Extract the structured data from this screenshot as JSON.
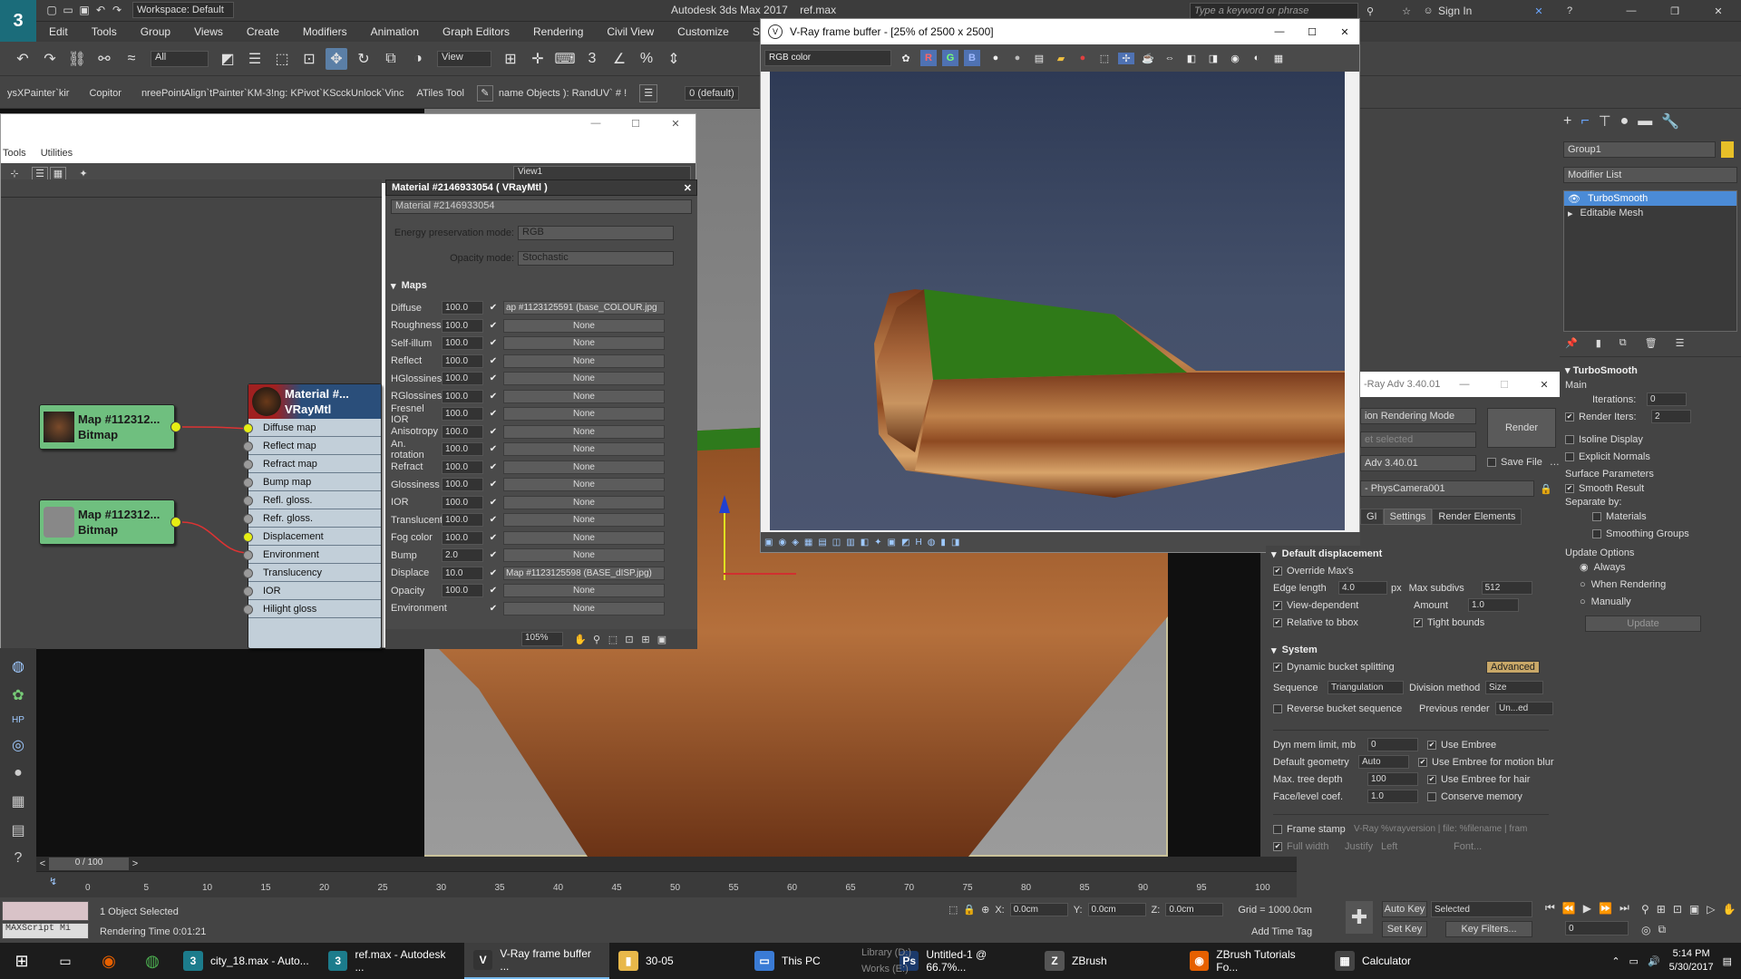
{
  "app": {
    "title": "Autodesk 3ds Max 2017",
    "file": "ref.max",
    "workspace": "Workspace: Default",
    "search_placeholder": "Type a keyword or phrase",
    "sign_in": "Sign In"
  },
  "menu": [
    "Edit",
    "Tools",
    "Group",
    "Views",
    "Create",
    "Modifiers",
    "Animation",
    "Graph Editors",
    "Rendering",
    "Civil View",
    "Customize",
    "Scripting"
  ],
  "toolbar": {
    "selection_filter": "All",
    "view_dropdown": "View"
  },
  "plugin_bar": [
    "ysXPainter`kir",
    "Copitor",
    "nreePointAlign`tPainter`KM-3!ng: KPivot`KScckUnlock`Vinc",
    "ATiles Tool",
    "name Objects ): RandUV` # !",
    "0 (default)"
  ],
  "slate": {
    "menu": [
      "Tools",
      "Utilities"
    ],
    "view_name": "View1",
    "nodes": {
      "map1_title": "Map #112312...",
      "map1_type": "Bitmap",
      "map2_title": "Map #112312...",
      "map2_type": "Bitmap",
      "mtl_title": "Material #...",
      "mtl_type": "VRayMtl"
    },
    "slots": [
      {
        "label": "Diffuse map",
        "connected": true
      },
      {
        "label": "Reflect map",
        "connected": false
      },
      {
        "label": "Refract map",
        "connected": false
      },
      {
        "label": "Bump map",
        "connected": false
      },
      {
        "label": "Refl. gloss.",
        "connected": false
      },
      {
        "label": "Refr. gloss.",
        "connected": false
      },
      {
        "label": "Displacement",
        "connected": true
      },
      {
        "label": "Environment",
        "connected": false
      },
      {
        "label": "Translucency",
        "connected": false
      },
      {
        "label": "IOR",
        "connected": false
      },
      {
        "label": "Hilight gloss",
        "connected": false
      }
    ],
    "zoom": "105%"
  },
  "params": {
    "header": "Material #2146933054  ( VRayMtl )",
    "name_field": "Material #2146933054",
    "energy_label": "Energy preservation mode:",
    "energy_value": "RGB",
    "opacity_label": "Opacity mode:",
    "opacity_value": "Stochastic",
    "maps_label": "Maps",
    "rows": [
      {
        "name": "Diffuse",
        "value": "100.0",
        "map": "ap #1123125591 (base_COLOUR.jpg"
      },
      {
        "name": "Roughness",
        "value": "100.0",
        "map": "None"
      },
      {
        "name": "Self-illum",
        "value": "100.0",
        "map": "None"
      },
      {
        "name": "Reflect",
        "value": "100.0",
        "map": "None"
      },
      {
        "name": "HGlossiness",
        "value": "100.0",
        "map": "None"
      },
      {
        "name": "RGlossiness",
        "value": "100.0",
        "map": "None"
      },
      {
        "name": "Fresnel IOR",
        "value": "100.0",
        "map": "None"
      },
      {
        "name": "Anisotropy",
        "value": "100.0",
        "map": "None"
      },
      {
        "name": "An. rotation",
        "value": "100.0",
        "map": "None"
      },
      {
        "name": "Refract",
        "value": "100.0",
        "map": "None"
      },
      {
        "name": "Glossiness",
        "value": "100.0",
        "map": "None"
      },
      {
        "name": "IOR",
        "value": "100.0",
        "map": "None"
      },
      {
        "name": "Translucent",
        "value": "100.0",
        "map": "None"
      },
      {
        "name": "Fog color",
        "value": "100.0",
        "map": "None"
      },
      {
        "name": "Bump",
        "value": "2.0",
        "map": "None"
      },
      {
        "name": "Displace",
        "value": "10.0",
        "map": "Map #1123125598 (BASE_dISP.jpg)"
      },
      {
        "name": "Opacity",
        "value": "100.0",
        "map": "None"
      },
      {
        "name": "Environment",
        "value": "",
        "map": "None"
      }
    ]
  },
  "vfb": {
    "title": "V-Ray frame buffer - [25% of 2500 x 2500]",
    "channel": "RGB color",
    "rgb_buttons": [
      "R",
      "G",
      "B"
    ]
  },
  "render_setup": {
    "title": "-Ray Adv 3.40.01",
    "mode": "ion Rendering Mode",
    "preset": "et selected",
    "renderer": "Adv 3.40.01",
    "camera": "- PhysCamera001",
    "render_button": "Render",
    "save_file": "Save File",
    "tabs": [
      "GI",
      "Settings",
      "Render Elements"
    ],
    "default_displacement": {
      "header": "Default displacement",
      "override": "Override Max's",
      "edge_length_label": "Edge length",
      "edge_length": "4.0",
      "px": "px",
      "max_subdivs_label": "Max subdivs",
      "max_subdivs": "512",
      "view_dependent": "View-dependent",
      "amount_label": "Amount",
      "amount": "1.0",
      "relative_bbox": "Relative to bbox",
      "tight_bounds": "Tight bounds"
    },
    "system": {
      "header": "System",
      "dynamic_split": "Dynamic bucket splitting",
      "advanced": "Advanced",
      "sequence_label": "Sequence",
      "sequence": "Triangulation",
      "division_label": "Division method",
      "division": "Size",
      "reverse": "Reverse bucket sequence",
      "previous_label": "Previous render",
      "previous": "Un...ed",
      "dyn_mem_label": "Dyn mem limit, mb",
      "dyn_mem": "0",
      "use_embree": "Use Embree",
      "default_geom_label": "Default geometry",
      "default_geom": "Auto",
      "embree_motion": "Use Embree for motion blur",
      "tree_depth_label": "Max. tree depth",
      "tree_depth": "100",
      "embree_hair": "Use Embree for hair",
      "face_level_label": "Face/level coef.",
      "face_level": "1.0",
      "conserve_memory": "Conserve memory",
      "frame_stamp": "Frame stamp",
      "frame_stamp_text": "V-Ray %vrayversion | file: %filename | fram",
      "full_width": "Full width",
      "justify": "Justify",
      "justify_value": "Left",
      "font": "Font..."
    }
  },
  "command_panel": {
    "object_name": "Group1",
    "modifier_list": "Modifier List",
    "stack": [
      "TurboSmooth",
      "Editable Mesh"
    ],
    "turbosmooth": {
      "header": "TurboSmooth",
      "main": "Main",
      "iterations_label": "Iterations:",
      "iterations": "0",
      "render_iters_label": "Render Iters:",
      "render_iters": "2",
      "isoline": "Isoline Display",
      "explicit_normals": "Explicit Normals",
      "surface_params": "Surface Parameters",
      "smooth_result": "Smooth Result",
      "separate_by": "Separate by:",
      "materials": "Materials",
      "smoothing_groups": "Smoothing Groups",
      "update_options": "Update Options",
      "always": "Always",
      "when_rendering": "When Rendering",
      "manually": "Manually",
      "update_button": "Update"
    }
  },
  "timeline": {
    "frame": "0 / 100",
    "ticks": [
      "0",
      "5",
      "10",
      "15",
      "20",
      "25",
      "30",
      "35",
      "40",
      "45",
      "50",
      "55",
      "60",
      "65",
      "70",
      "75",
      "80",
      "85",
      "90",
      "95",
      "100"
    ]
  },
  "status": {
    "selected": "1 Object Selected",
    "render_time": "Rendering Time  0:01:21",
    "maxscript": "MAXScript Mi",
    "x_label": "X:",
    "x": "0.0cm",
    "y_label": "Y:",
    "y": "0.0cm",
    "z_label": "Z:",
    "z": "0.0cm",
    "grid": "Grid = 1000.0cm",
    "add_time_tag": "Add Time Tag",
    "auto_key": "Auto Key",
    "selected_dropdown": "Selected",
    "set_key": "Set Key",
    "key_filters": "Key Filters...",
    "frame_field": "0"
  },
  "taskbar": {
    "items": [
      {
        "label": "city_18.max - Auto...",
        "icon": "3",
        "color": "#1c7c8c"
      },
      {
        "label": "ref.max - Autodesk ...",
        "icon": "3",
        "color": "#1c7c8c"
      },
      {
        "label": "V-Ray frame buffer ...",
        "icon": "V",
        "color": "#333333",
        "active": true
      },
      {
        "label": "30-05",
        "icon": "▮",
        "color": "#e8b84a"
      },
      {
        "label": "This PC",
        "icon": "▭",
        "color": "#3a7bd5"
      },
      {
        "label": "Untitled-1 @ 66.7%...",
        "icon": "Ps",
        "color": "#1b3a6b"
      },
      {
        "label": "ZBrush",
        "icon": "Z",
        "color": "#555555"
      },
      {
        "label": "ZBrush Tutorials Fo...",
        "icon": "◉",
        "color": "#e66000"
      },
      {
        "label": "Calculator",
        "icon": "▦",
        "color": "#444444"
      }
    ],
    "tray_overlay": [
      "Library (D:)",
      "Works (E:)"
    ],
    "time": "5:14 PM",
    "date": "5/30/2017"
  },
  "colors": {
    "accent_blue": "#4b8bd6",
    "node_green": "#6fbf7f",
    "slot_yellow": "#e6ee14",
    "taskbar": "#1c1c1c"
  }
}
